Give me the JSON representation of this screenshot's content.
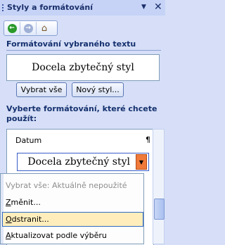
{
  "pane": {
    "title": "Styly a formátování",
    "dropdown_glyph": "▼",
    "close_glyph": "✕"
  },
  "nav": {
    "back_icon": "back-arrow-icon",
    "forward_icon": "forward-arrow-icon",
    "home_icon": "home-icon",
    "back_glyph": "←",
    "forward_glyph": "→",
    "home_glyph": "⌂"
  },
  "selected_format": {
    "heading": "Formátování vybraného textu",
    "preview_text": "Docela zbytečný styl",
    "select_all_label": "Vybrat vše",
    "new_style_label": "Nový styl..."
  },
  "apply": {
    "heading": "Vyberte formátování, které chcete použít:",
    "items": [
      {
        "label": "Datum",
        "mark": "¶"
      }
    ],
    "selected_item": "Docela zbytečný styl",
    "selected_dropdown_glyph": "▼"
  },
  "context_menu": {
    "items": [
      {
        "label": "Vybrat vše: Aktuálně nepoužité",
        "state": "disabled"
      },
      {
        "label_underlined": "Z",
        "label_rest": "měnit...",
        "state": "normal"
      },
      {
        "label_underlined": "O",
        "label_rest": "dstranit...",
        "state": "hover"
      },
      {
        "label_underlined": "A",
        "label_rest": "ktualizovat podle výběru",
        "state": "normal"
      }
    ]
  },
  "colors": {
    "pane_bg": "#d6dff7",
    "heading_text": "#15306e",
    "dropdown_button": "#f07a3a",
    "menu_hover": "#ffeebc"
  }
}
